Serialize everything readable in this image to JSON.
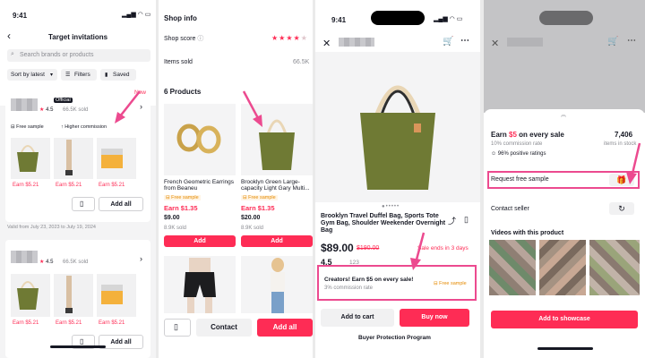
{
  "p1": {
    "time": "9:41",
    "title": "Target invitations",
    "search_placeholder": "Search brands or products",
    "sort_label": "Sort by latest",
    "filters_label": "Filters",
    "saved_label": "Saved",
    "card1": {
      "new_badge": "New",
      "official_badge": "Official",
      "rating": "4.5",
      "sold": "66.5K sold",
      "tag_free": "Free sample",
      "tag_comm": "Higher commission",
      "earn": [
        "Earn $5.21",
        "Earn $5.21",
        "Earn $5.21"
      ],
      "add_all": "Add all"
    },
    "valid_text": "Valid from July 23, 2023 to July 19, 2024",
    "card2": {
      "rating": "4.5",
      "sold": "66.5K sold",
      "earn": [
        "Earn $5.21",
        "Earn $5.21",
        "Earn $5.21"
      ],
      "add_all": "Add all"
    }
  },
  "p2": {
    "shop_info": "Shop info",
    "shop_score_label": "Shop score",
    "items_sold_label": "Items sold",
    "items_sold_value": "66.5K",
    "products_heading": "6 Products",
    "prod1": {
      "name": "French Geometric Earrings from Beaneu",
      "tag": "Free sample",
      "earn": "Earn $1.35",
      "price": "$9.00",
      "sold": "8.9K sold",
      "add": "Add"
    },
    "prod2": {
      "name": "Brooklyn Green Large-capacity Light Gary Multi...",
      "tag": "Free sample",
      "earn": "Earn $1.35",
      "price": "$20.00",
      "sold": "8.9K sold",
      "add": "Add"
    },
    "contact": "Contact",
    "add_all": "Add all"
  },
  "p3": {
    "time": "9:41",
    "product_title": "Brooklyn Travel Duffel Bag, Sports Tote Gym Bag, Shoulder Weekender Overnight Bag",
    "price": "$89.00",
    "old_price": "$190.00",
    "sale_ends": "Sale ends in 3 days",
    "rating": "4.5",
    "rating_count": "123",
    "creator_title": "Creators! Earn $5 on every sale!",
    "creator_sub": "3% commission rate",
    "free_sample": "Free sample",
    "add_to_cart": "Add to cart",
    "buy_now": "Buy now",
    "buyer_protection": "Buyer Protection Program"
  },
  "p4": {
    "earn_prefix": "Earn ",
    "earn_amount": "$5",
    "earn_suffix": " on every sale",
    "commission": "10% commission rate",
    "positive": "96% positive ratings",
    "stock_count": "7,406",
    "stock_label": "items in stock",
    "request_sample": "Request free sample",
    "contact_seller": "Contact seller",
    "videos_heading": "Videos with this product",
    "showcase": "Add to showcase"
  },
  "colors": {
    "accent": "#fe2c55",
    "bag_green": "#6f7a34",
    "gold": "#c9a24a"
  }
}
